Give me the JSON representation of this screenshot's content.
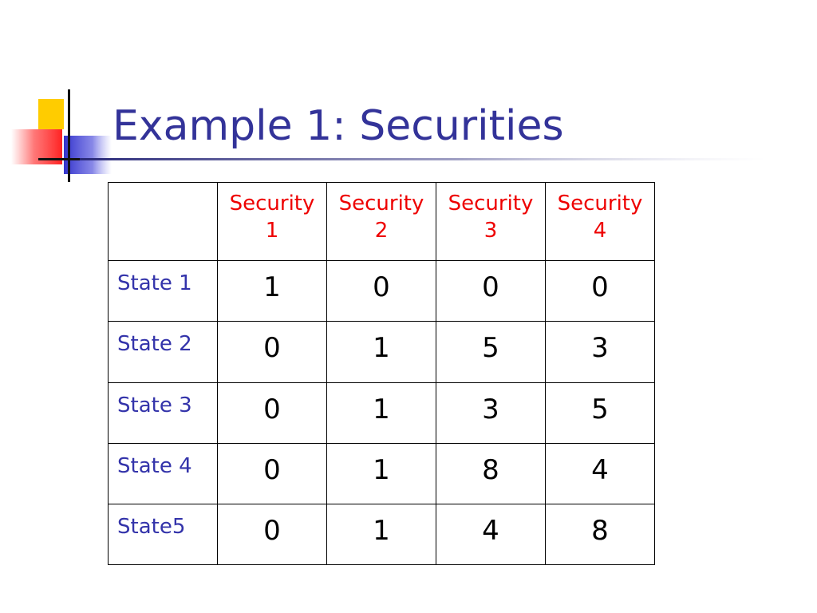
{
  "slide": {
    "title": "Example 1: Securities"
  },
  "table": {
    "corner": "",
    "columns": [
      {
        "line1": "Security",
        "line2": "1"
      },
      {
        "line1": "Security",
        "line2": "2"
      },
      {
        "line1": "Security",
        "line2": "3"
      },
      {
        "line1": "Security",
        "line2": "4"
      }
    ],
    "rows": [
      {
        "label": "State 1",
        "values": [
          "1",
          "0",
          "0",
          "0"
        ]
      },
      {
        "label": "State 2",
        "values": [
          "0",
          "1",
          "5",
          "3"
        ]
      },
      {
        "label": "State 3",
        "values": [
          "0",
          "1",
          "3",
          "5"
        ]
      },
      {
        "label": "State 4",
        "values": [
          "0",
          "1",
          "8",
          "4"
        ]
      },
      {
        "label": "State5",
        "values": [
          "0",
          "1",
          "4",
          "8"
        ]
      }
    ]
  },
  "colors": {
    "title": "#333399",
    "header_text": "#ee0000",
    "row_label_text": "#3333aa",
    "deco_yellow": "#ffcc00",
    "deco_red": "#ff3333",
    "deco_blue": "#3333cc"
  }
}
